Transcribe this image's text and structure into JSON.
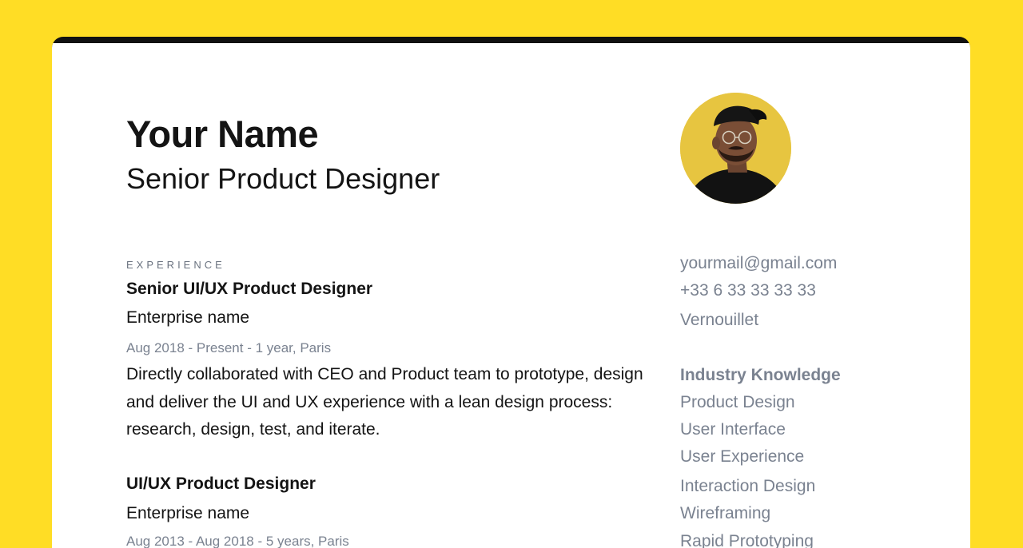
{
  "header": {
    "name": "Your Name",
    "title": "Senior Product Designer"
  },
  "experience": {
    "section_label": "EXPERIENCE",
    "jobs": [
      {
        "title": "Senior UI/UX Product Designer",
        "company": "Enterprise name",
        "meta": "Aug 2018 - Present - 1 year, Paris",
        "description": "Directly collaborated with CEO and Product team to prototype, design and deliver the UI and UX experience with a lean design process: research, design, test, and iterate."
      },
      {
        "title": "UI/UX Product Designer",
        "company": "Enterprise name",
        "meta": "Aug 2013 - Aug 2018 - 5 years, Paris"
      }
    ]
  },
  "contact": {
    "email": "yourmail@gmail.com",
    "phone": "+33 6 33 33 33 33",
    "location": "Vernouillet"
  },
  "skills": {
    "title": "Industry Knowledge",
    "items": [
      "Product Design",
      "User Interface",
      "User Experience",
      "Interaction Design",
      "Wireframing",
      "Rapid Prototyping"
    ]
  },
  "colors": {
    "background": "#FFDD25",
    "frame": "#111111",
    "sheet": "#FFFFFF",
    "text_primary": "#141414",
    "text_secondary": "#7A8290"
  }
}
